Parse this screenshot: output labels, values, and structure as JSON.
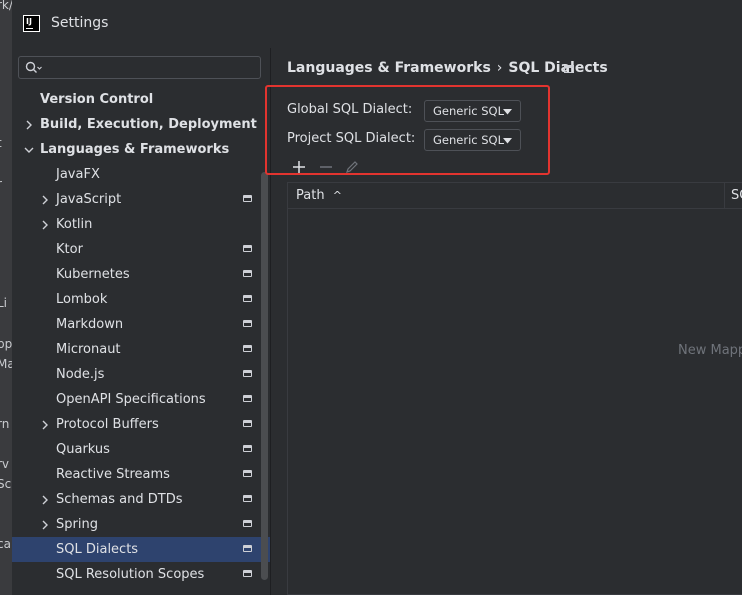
{
  "window": {
    "title": "Settings",
    "app_icon_text": "IJ"
  },
  "background_fragments": [
    "rk/my-training",
    "t",
    "r",
    "Li",
    "pp",
    "Ma",
    "rn",
    "rv",
    "Sc",
    "cal"
  ],
  "search": {
    "placeholder": ""
  },
  "sidebar": {
    "items": [
      {
        "label": "Version Control",
        "level": 0,
        "arrow": "",
        "bold": true,
        "project_icon": false,
        "selected": false
      },
      {
        "label": "Build, Execution, Deployment",
        "level": 0,
        "arrow": "right",
        "bold": true,
        "project_icon": false,
        "selected": false
      },
      {
        "label": "Languages & Frameworks",
        "level": 0,
        "arrow": "down",
        "bold": true,
        "project_icon": false,
        "selected": false
      },
      {
        "label": "JavaFX",
        "level": 1,
        "arrow": "",
        "bold": false,
        "project_icon": false,
        "selected": false
      },
      {
        "label": "JavaScript",
        "level": 1,
        "arrow": "right",
        "bold": false,
        "project_icon": true,
        "selected": false
      },
      {
        "label": "Kotlin",
        "level": 1,
        "arrow": "right",
        "bold": false,
        "project_icon": false,
        "selected": false
      },
      {
        "label": "Ktor",
        "level": 1,
        "arrow": "",
        "bold": false,
        "project_icon": true,
        "selected": false
      },
      {
        "label": "Kubernetes",
        "level": 1,
        "arrow": "",
        "bold": false,
        "project_icon": true,
        "selected": false
      },
      {
        "label": "Lombok",
        "level": 1,
        "arrow": "",
        "bold": false,
        "project_icon": true,
        "selected": false
      },
      {
        "label": "Markdown",
        "level": 1,
        "arrow": "",
        "bold": false,
        "project_icon": true,
        "selected": false
      },
      {
        "label": "Micronaut",
        "level": 1,
        "arrow": "",
        "bold": false,
        "project_icon": true,
        "selected": false
      },
      {
        "label": "Node.js",
        "level": 1,
        "arrow": "",
        "bold": false,
        "project_icon": true,
        "selected": false
      },
      {
        "label": "OpenAPI Specifications",
        "level": 1,
        "arrow": "",
        "bold": false,
        "project_icon": true,
        "selected": false
      },
      {
        "label": "Protocol Buffers",
        "level": 1,
        "arrow": "right",
        "bold": false,
        "project_icon": true,
        "selected": false
      },
      {
        "label": "Quarkus",
        "level": 1,
        "arrow": "",
        "bold": false,
        "project_icon": true,
        "selected": false
      },
      {
        "label": "Reactive Streams",
        "level": 1,
        "arrow": "",
        "bold": false,
        "project_icon": true,
        "selected": false
      },
      {
        "label": "Schemas and DTDs",
        "level": 1,
        "arrow": "right",
        "bold": false,
        "project_icon": true,
        "selected": false
      },
      {
        "label": "Spring",
        "level": 1,
        "arrow": "right",
        "bold": false,
        "project_icon": true,
        "selected": false
      },
      {
        "label": "SQL Dialects",
        "level": 1,
        "arrow": "",
        "bold": false,
        "project_icon": true,
        "selected": true
      },
      {
        "label": "SQL Resolution Scopes",
        "level": 1,
        "arrow": "",
        "bold": false,
        "project_icon": true,
        "selected": false
      }
    ]
  },
  "breadcrumb": {
    "parent": "Languages & Frameworks",
    "separator": "›",
    "current": "SQL Dialects"
  },
  "dialects": {
    "global_label": "Global SQL Dialect:",
    "global_value": "Generic SQL",
    "project_label": "Project SQL Dialect:",
    "project_value": "Generic SQL"
  },
  "toolbar": {
    "add_icon": "plus-icon",
    "remove_icon": "minus-icon",
    "edit_icon": "pencil-icon"
  },
  "table": {
    "columns": [
      "Path",
      "SQ"
    ],
    "sort_indicator": "^",
    "empty_text": "New Mapp"
  },
  "colors": {
    "selection": "#2e436e",
    "highlight_box": "#e3342f",
    "background": "#2b2d30"
  }
}
